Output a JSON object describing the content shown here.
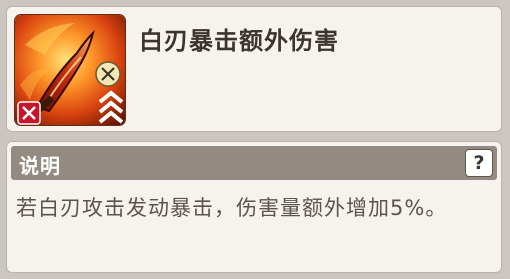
{
  "skill": {
    "title": "白刃暴击额外伤害",
    "icon": "flaming-blade-skill-icon",
    "badges": [
      "crossed-swords-icon",
      "disabled-swords-icon",
      "triple-chevron-up-icon"
    ]
  },
  "description": {
    "header": "说明",
    "help_label": "?",
    "text": "若白刃攻击发动暴击，伤害量额外增加5%。"
  },
  "colors": {
    "card_bg": "#f6f3ee",
    "header_bg": "#938b81",
    "title_text": "#3a3530",
    "body_text": "#5a544e",
    "icon_fire_orange": "#e8641c",
    "icon_red": "#c8142a"
  }
}
